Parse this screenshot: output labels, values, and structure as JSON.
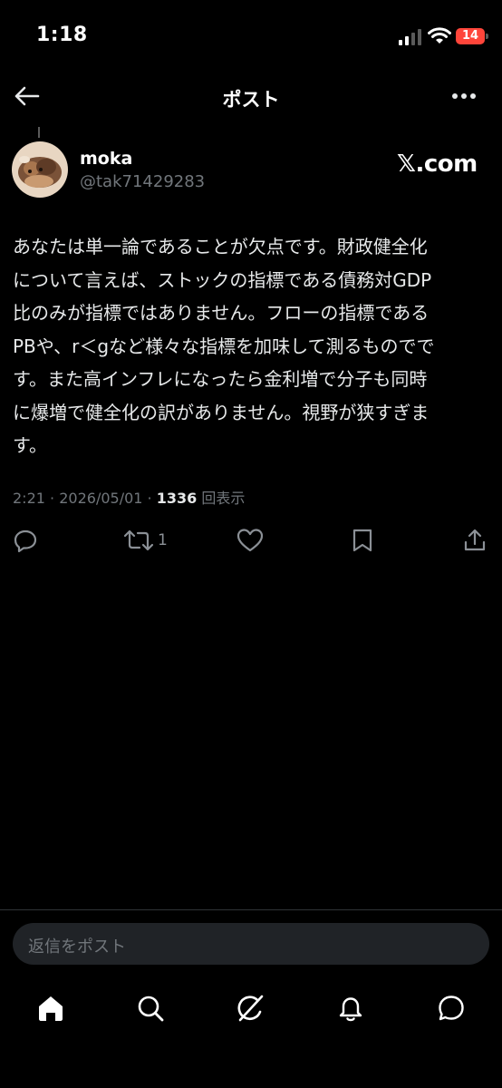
{
  "status_bar": {
    "time": "1:18",
    "battery_level": "14"
  },
  "header": {
    "title": "ポスト"
  },
  "author": {
    "name": "moka",
    "handle": "@tak71429283"
  },
  "source_badge": "𝕏.com",
  "post": {
    "lines": [
      "あなたは単一論であることが欠点です。財政健全化",
      "について言えば、ストックの指標である債務対GDP",
      "比のみが指標ではありません。フローの指標である",
      "PBや、r＜gなど様々な指標を加味して測るものでで",
      "す。また高インフレになったら金利増で分子も同時",
      "に爆増で健全化の訳がありません。視野が狭すぎま",
      "す。"
    ],
    "time": "2:21",
    "date": "2026/05/01",
    "separator": "·",
    "views": "1336",
    "views_label": "回表示"
  },
  "actions": {
    "retweet_count": "1"
  },
  "reply_bar": {
    "placeholder": "返信をポスト"
  },
  "colors": {
    "background": "#000000",
    "text": "#e7e9ea",
    "muted": "#71767b",
    "battery": "#ff453a"
  },
  "icons": [
    "back-arrow-icon",
    "more-icon",
    "reply-icon",
    "retweet-icon",
    "like-icon",
    "bookmark-icon",
    "share-icon",
    "home-icon",
    "search-icon",
    "grok-icon",
    "notifications-icon",
    "messages-icon"
  ]
}
